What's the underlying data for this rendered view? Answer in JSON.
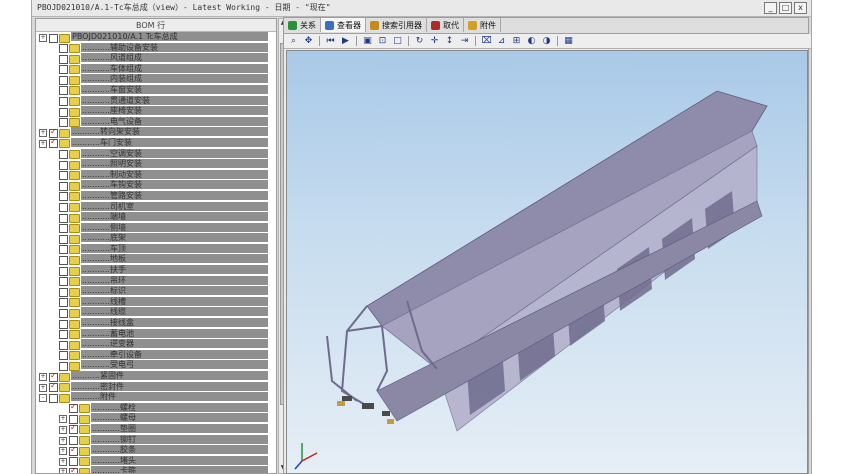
{
  "window": {
    "title": "PBOJD021010/A.1-Tc车总成（view）- Latest Working - 日期 - \"现在\"",
    "min_label": "_",
    "max_label": "□",
    "close_label": "x"
  },
  "bom": {
    "header": "BOM 行",
    "rows": [
      {
        "indent": 0,
        "expander": "+",
        "checked": false,
        "text": "PBOJD021010/A.1 Tc车总成"
      },
      {
        "indent": 1,
        "expander": "",
        "checked": false,
        "text": "...........辅助设备安装"
      },
      {
        "indent": 1,
        "expander": "",
        "checked": false,
        "text": "...........风道组成"
      },
      {
        "indent": 1,
        "expander": "",
        "checked": false,
        "text": "...........车体组成"
      },
      {
        "indent": 1,
        "expander": "",
        "checked": false,
        "text": "...........内装组成"
      },
      {
        "indent": 1,
        "expander": "",
        "checked": false,
        "text": "...........车窗安装"
      },
      {
        "indent": 1,
        "expander": "",
        "checked": false,
        "text": "...........贯通道安装"
      },
      {
        "indent": 1,
        "expander": "",
        "checked": false,
        "text": "...........座椅安装"
      },
      {
        "indent": 1,
        "expander": "",
        "checked": false,
        "text": "...........电气设备"
      },
      {
        "indent": 0,
        "expander": "+",
        "checked": true,
        "text": "...........转向架安装"
      },
      {
        "indent": 0,
        "expander": "+",
        "checked": true,
        "text": "...........车门安装"
      },
      {
        "indent": 1,
        "expander": "",
        "checked": false,
        "text": "...........空调安装"
      },
      {
        "indent": 1,
        "expander": "",
        "checked": false,
        "text": "...........照明安装"
      },
      {
        "indent": 1,
        "expander": "",
        "checked": false,
        "text": "...........制动安装"
      },
      {
        "indent": 1,
        "expander": "",
        "checked": false,
        "text": "...........车钩安装"
      },
      {
        "indent": 1,
        "expander": "",
        "checked": false,
        "text": "...........管路安装"
      },
      {
        "indent": 1,
        "expander": "",
        "checked": false,
        "text": "...........司机室"
      },
      {
        "indent": 1,
        "expander": "",
        "checked": false,
        "text": "...........端墙"
      },
      {
        "indent": 1,
        "expander": "",
        "checked": false,
        "text": "...........侧墙"
      },
      {
        "indent": 1,
        "expander": "",
        "checked": false,
        "text": "...........底架"
      },
      {
        "indent": 1,
        "expander": "",
        "checked": false,
        "text": "...........车顶"
      },
      {
        "indent": 1,
        "expander": "",
        "checked": false,
        "text": "...........地板"
      },
      {
        "indent": 1,
        "expander": "",
        "checked": false,
        "text": "...........扶手"
      },
      {
        "indent": 1,
        "expander": "",
        "checked": false,
        "text": "...........吊环"
      },
      {
        "indent": 1,
        "expander": "",
        "checked": false,
        "text": "...........标识"
      },
      {
        "indent": 1,
        "expander": "",
        "checked": false,
        "text": "...........线槽"
      },
      {
        "indent": 1,
        "expander": "",
        "checked": false,
        "text": "...........线缆"
      },
      {
        "indent": 1,
        "expander": "",
        "checked": false,
        "text": "...........接线盒"
      },
      {
        "indent": 1,
        "expander": "",
        "checked": false,
        "text": "...........蓄电池"
      },
      {
        "indent": 1,
        "expander": "",
        "checked": false,
        "text": "...........逆变器"
      },
      {
        "indent": 1,
        "expander": "",
        "checked": false,
        "text": "...........牵引设备"
      },
      {
        "indent": 1,
        "expander": "",
        "checked": false,
        "text": "...........受电弓"
      },
      {
        "indent": 0,
        "expander": "+",
        "checked": true,
        "text": "...........紧固件"
      },
      {
        "indent": 0,
        "expander": "+",
        "checked": true,
        "text": "...........密封件"
      },
      {
        "indent": 0,
        "expander": "-",
        "checked": false,
        "text": "...........附件"
      },
      {
        "indent": 2,
        "expander": "",
        "checked": true,
        "text": "...........螺栓"
      },
      {
        "indent": 2,
        "expander": "+",
        "checked": false,
        "text": "...........螺母"
      },
      {
        "indent": 2,
        "expander": "+",
        "checked": true,
        "text": "...........垫圈"
      },
      {
        "indent": 2,
        "expander": "+",
        "checked": false,
        "text": "...........铆钉"
      },
      {
        "indent": 2,
        "expander": "+",
        "checked": true,
        "text": "...........胶条"
      },
      {
        "indent": 2,
        "expander": "+",
        "checked": false,
        "text": "...........堵头"
      },
      {
        "indent": 2,
        "expander": "+",
        "checked": true,
        "text": "...........卡箍"
      }
    ]
  },
  "tabs": [
    {
      "label": "关系",
      "icon": "relation-icon",
      "color": "#2c8f3a"
    },
    {
      "label": "查看器",
      "icon": "viewer-icon",
      "color": "#3a6fc4"
    },
    {
      "label": "搜索引用器",
      "icon": "search-ref-icon",
      "color": "#c48a1a"
    },
    {
      "label": "取代",
      "icon": "replace-icon",
      "color": "#b02a2a"
    },
    {
      "label": "附件",
      "icon": "attachment-icon",
      "color": "#d4a020"
    }
  ],
  "toolbar": [
    {
      "name": "zoom-icon",
      "glyph": "⌕"
    },
    {
      "name": "pan-icon",
      "glyph": "✥"
    },
    {
      "name": "sep"
    },
    {
      "name": "first-icon",
      "glyph": "⏮"
    },
    {
      "name": "play-icon",
      "glyph": "▶"
    },
    {
      "name": "sep"
    },
    {
      "name": "zoom-fit-icon",
      "glyph": "▣"
    },
    {
      "name": "zoom-area-icon",
      "glyph": "⊡"
    },
    {
      "name": "frame-icon",
      "glyph": "□"
    },
    {
      "name": "sep"
    },
    {
      "name": "rotate-icon",
      "glyph": "↻"
    },
    {
      "name": "move-icon",
      "glyph": "✛"
    },
    {
      "name": "vertical-icon",
      "glyph": "↕"
    },
    {
      "name": "align-icon",
      "glyph": "⇥"
    },
    {
      "name": "sep"
    },
    {
      "name": "clip-icon",
      "glyph": "⌧"
    },
    {
      "name": "measure-icon",
      "glyph": "⊿"
    },
    {
      "name": "section-icon",
      "glyph": "⊞"
    },
    {
      "name": "hide-icon",
      "glyph": "◐"
    },
    {
      "name": "show-icon",
      "glyph": "◑"
    },
    {
      "name": "sep"
    },
    {
      "name": "screenshot-icon",
      "glyph": "▦"
    }
  ],
  "colors": {
    "viewport_top": "#a9c9e8",
    "viewport_bottom": "#e6eef6",
    "model": "#9a98b6",
    "model_dark": "#6e6c8c"
  }
}
